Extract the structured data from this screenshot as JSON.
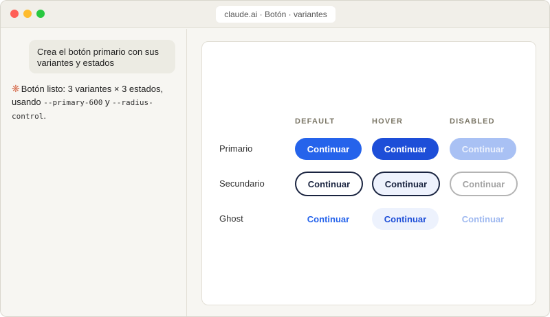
{
  "window": {
    "url": "claude.ai · Botón · variantes"
  },
  "chat": {
    "user_message": "Crea el botón primario con sus variantes y estados",
    "assistant": {
      "icon": "sparkle-icon",
      "text_before": "Botón listo: 3 variantes × 3 estados, usando ",
      "code1": "--primary-600",
      "text_between": " y ",
      "code2": "--radius-control",
      "text_after": "."
    }
  },
  "preview": {
    "columns": [
      "DEFAULT",
      "HOVER",
      "DISABLED"
    ],
    "rows": [
      {
        "label": "Primario",
        "buttons": [
          "Continuar",
          "Continuar",
          "Continuar"
        ]
      },
      {
        "label": "Secundario",
        "buttons": [
          "Continuar",
          "Continuar",
          "Continuar"
        ]
      },
      {
        "label": "Ghost",
        "buttons": [
          "Continuar",
          "Continuar",
          "Continuar"
        ]
      }
    ]
  },
  "colors": {
    "primary_600": "#2563eb",
    "primary_700": "#1d4ed8",
    "secondary_border": "#1a2440",
    "accent_sparkle": "#d9775a"
  }
}
